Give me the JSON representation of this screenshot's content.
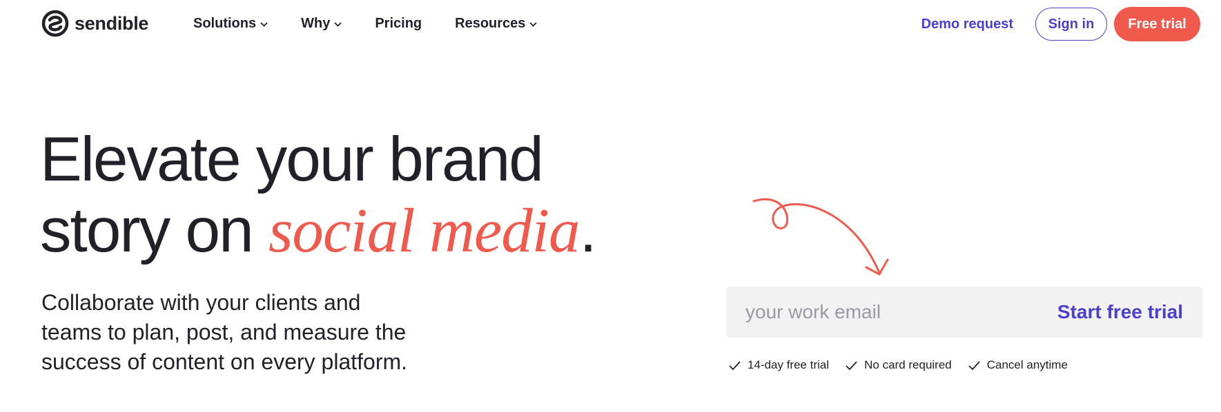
{
  "brand": {
    "name": "sendible",
    "accent_color": "#f05a4c",
    "link_color": "#4a3fd1"
  },
  "nav": {
    "items": [
      {
        "label": "Solutions",
        "has_dropdown": true
      },
      {
        "label": "Why",
        "has_dropdown": true
      },
      {
        "label": "Pricing",
        "has_dropdown": false
      },
      {
        "label": "Resources",
        "has_dropdown": true
      }
    ],
    "demo_label": "Demo request",
    "signin_label": "Sign in",
    "trial_label": "Free trial"
  },
  "hero": {
    "title_line1": "Elevate your brand",
    "title_line2_prefix": "story on ",
    "title_accent": "social media",
    "title_suffix": ".",
    "subtitle": "Collaborate with your clients and teams to plan, post, and measure the success of content on every platform."
  },
  "signup": {
    "email_placeholder": "your work email",
    "email_value": "",
    "button_label": "Start free trial",
    "perks": [
      "14-day free trial",
      "No card required",
      "Cancel anytime"
    ]
  }
}
